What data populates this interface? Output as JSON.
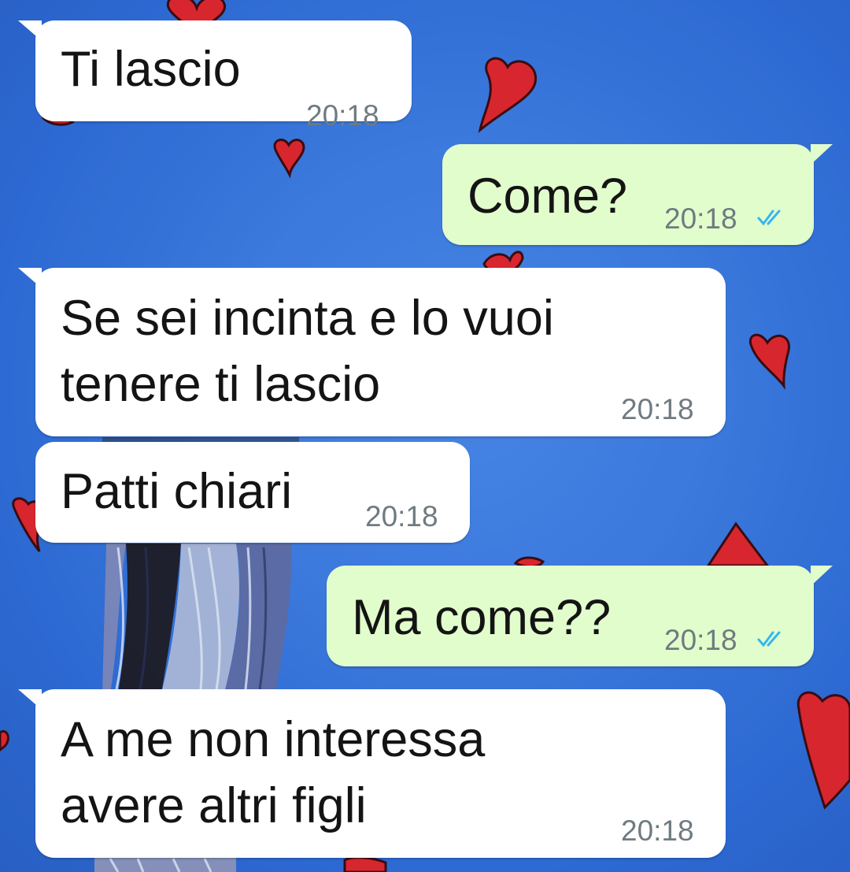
{
  "chat": {
    "wallpaper": {
      "background_color": "#3f80e4",
      "heart_color": "#d8262e"
    },
    "colors": {
      "incoming_bubble": "#ffffff",
      "outgoing_bubble": "#e2fdcc",
      "read_ticks": "#34b7f1",
      "timestamp": "#6f7b80"
    },
    "messages": [
      {
        "direction": "incoming",
        "text": "Ti lascio",
        "time": "20:18"
      },
      {
        "direction": "outgoing",
        "text": "Come?",
        "time": "20:18",
        "status_icon": "double-check-read-icon"
      },
      {
        "direction": "incoming",
        "text": "Se sei incinta e lo vuoi\ntenere ti lascio",
        "time": "20:18"
      },
      {
        "direction": "incoming",
        "text": "Patti chiari",
        "time": "20:18"
      },
      {
        "direction": "outgoing",
        "text": "Ma come??",
        "time": "20:18",
        "status_icon": "double-check-read-icon"
      },
      {
        "direction": "incoming",
        "text": "A me non interessa\navere altri figli",
        "time": "20:18"
      }
    ]
  }
}
